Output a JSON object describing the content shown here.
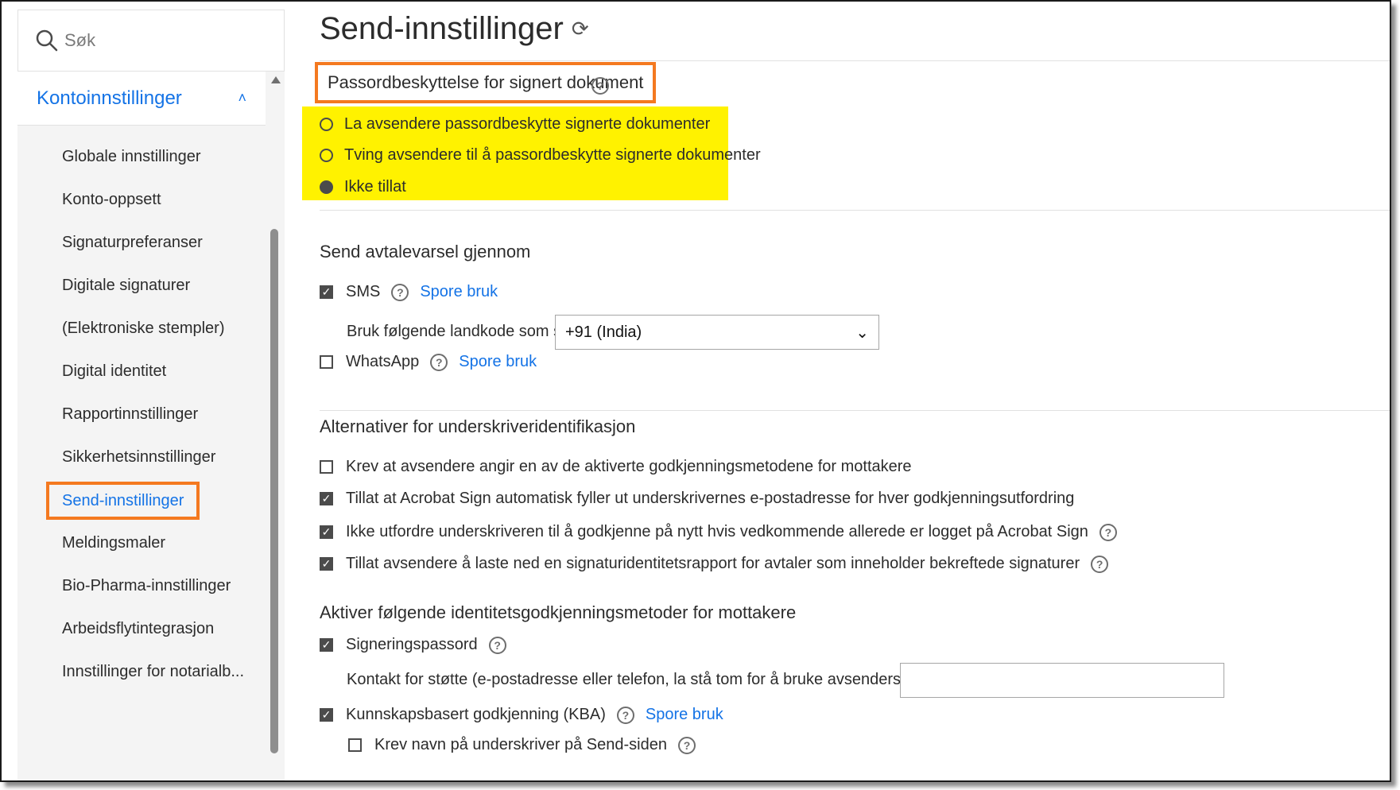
{
  "search": {
    "placeholder": "Søk",
    "icon": "search-icon"
  },
  "sidebar": {
    "section_label": "Kontoinnstillinger",
    "items": [
      {
        "label": "Globale innstillinger"
      },
      {
        "label": "Konto-oppsett"
      },
      {
        "label": "Signaturpreferanser"
      },
      {
        "label": "Digitale signaturer"
      },
      {
        "label": "(Elektroniske stempler)"
      },
      {
        "label": "Digital identitet"
      },
      {
        "label": "Rapportinnstillinger"
      },
      {
        "label": "Sikkerhetsinnstillinger"
      },
      {
        "label": "Send-innstillinger",
        "active": true
      },
      {
        "label": "Meldingsmaler"
      },
      {
        "label": "Bio-Pharma-innstillinger"
      },
      {
        "label": "Arbeidsflytintegrasjon"
      },
      {
        "label": "Innstillinger for notarialb..."
      }
    ]
  },
  "main": {
    "title": "Send-innstillinger",
    "password": {
      "title": "Passordbeskyttelse for signert dokument",
      "options": [
        {
          "label": "La avsendere passordbeskytte signerte dokumenter",
          "selected": false
        },
        {
          "label": "Tving avsendere til å passordbeskytte signerte dokumenter",
          "selected": false
        },
        {
          "label": "Ikke tillat",
          "selected": true
        }
      ]
    },
    "notify": {
      "title": "Send avtalevarsel gjennom",
      "sms_label": "SMS",
      "sms_checked": true,
      "track_label": "Spore bruk",
      "country_label": "Bruk følgende landkode som standard:",
      "country_value": "+91 (India)",
      "whatsapp_label": "WhatsApp",
      "whatsapp_checked": false
    },
    "signer_id": {
      "title": "Alternativer for underskriveridentifikasjon",
      "options": [
        {
          "label": "Krev at avsendere angir en av de aktiverte godkjenningsmetodene for mottakere",
          "checked": false
        },
        {
          "label": "Tillat at Acrobat Sign automatisk fyller ut underskrivernes e-postadresse for hver godkjenningsutfordring",
          "checked": true
        },
        {
          "label": "Ikke utfordre underskriveren til å godkjenne på nytt hvis vedkommende allerede er logget på Acrobat Sign",
          "checked": true
        },
        {
          "label": "Tillat avsendere å laste ned en signaturidentitetsrapport for avtaler som inneholder bekreftede signaturer",
          "checked": true
        }
      ]
    },
    "auth": {
      "title": "Aktiver følgende identitetsgodkjenningsmetoder for mottakere",
      "signing_password_label": "Signeringspassord",
      "signing_password_checked": true,
      "support_contact_label": "Kontakt for støtte (e-postadresse eller telefon, la stå tom for å bruke avsenders e-postadresse):",
      "support_contact_value": "",
      "kba_label": "Kunnskapsbasert godkjenning (KBA)",
      "kba_checked": true,
      "kba_track_label": "Spore bruk",
      "require_name_label": "Krev navn på underskriver på Send-siden",
      "require_name_checked": false
    }
  },
  "colors": {
    "accent": "#1473e6",
    "callout_border": "#f47920",
    "highlight": "#fff200"
  }
}
